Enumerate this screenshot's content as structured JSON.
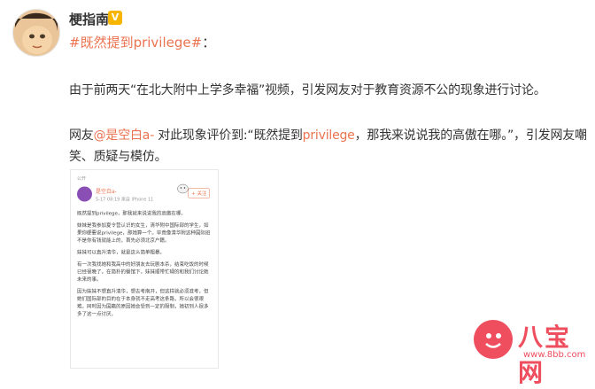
{
  "post": {
    "author": "梗指南",
    "topic": "#既然提到privilege#",
    "topic_colon": "：",
    "paragraph1": "由于前两天“在北大附中上学多幸福”视频，引发网友对于教育资源不公的现象进行讨论。",
    "paragraph2": {
      "prefix": "网友",
      "mention": "@是空白a-",
      "middle": " 对此现象评价到:“既然提到",
      "keyword": "privilege",
      "suffix": "，那我来说说我的高傲在哪。”，引发网友嘲笑、质疑与模仿。"
    }
  },
  "screenshot": {
    "scope": "公开",
    "user_name": "是空白a-",
    "meta": "5-17 08:19  来自 iPhone 11",
    "follow_label": "+ 关注",
    "paragraphs": [
      "既然提到privilege，那我就来说说我的高傲在哪。",
      "妹妹是我参加夏令营认识的女生，清华附中国际部的学生，如果你硬要说privilege，那她算一个。毕竟像清华附这种国际班不是你有钱就能上的，首先必须北京户籍。",
      "妹妹可以直升清华，就是这么简单粗暴。",
      "有一次我找她和我高中的好朋友去玩剧本杀，结束吃饭的时候已经很晚了，在简朴的餐馆下，妹妹顺带忙碌的和我们讨论她未来的事。",
      "因为妹妹不想直升清华，想去考南开，但这样就必须准考，但她们国际部的目的在于本身就不走高考这条路，所以会很艰难。同时因为国籍的原因她会受到一定的限制，她初到人很多多了这一点讨厌，"
    ]
  },
  "watermark": {
    "logo_text": "八宝网",
    "url": "www.8bb.com"
  },
  "colors": {
    "link": "#eb7350",
    "text": "#333333",
    "watermark": "#ef4e5e",
    "badge": "#f7b500"
  }
}
